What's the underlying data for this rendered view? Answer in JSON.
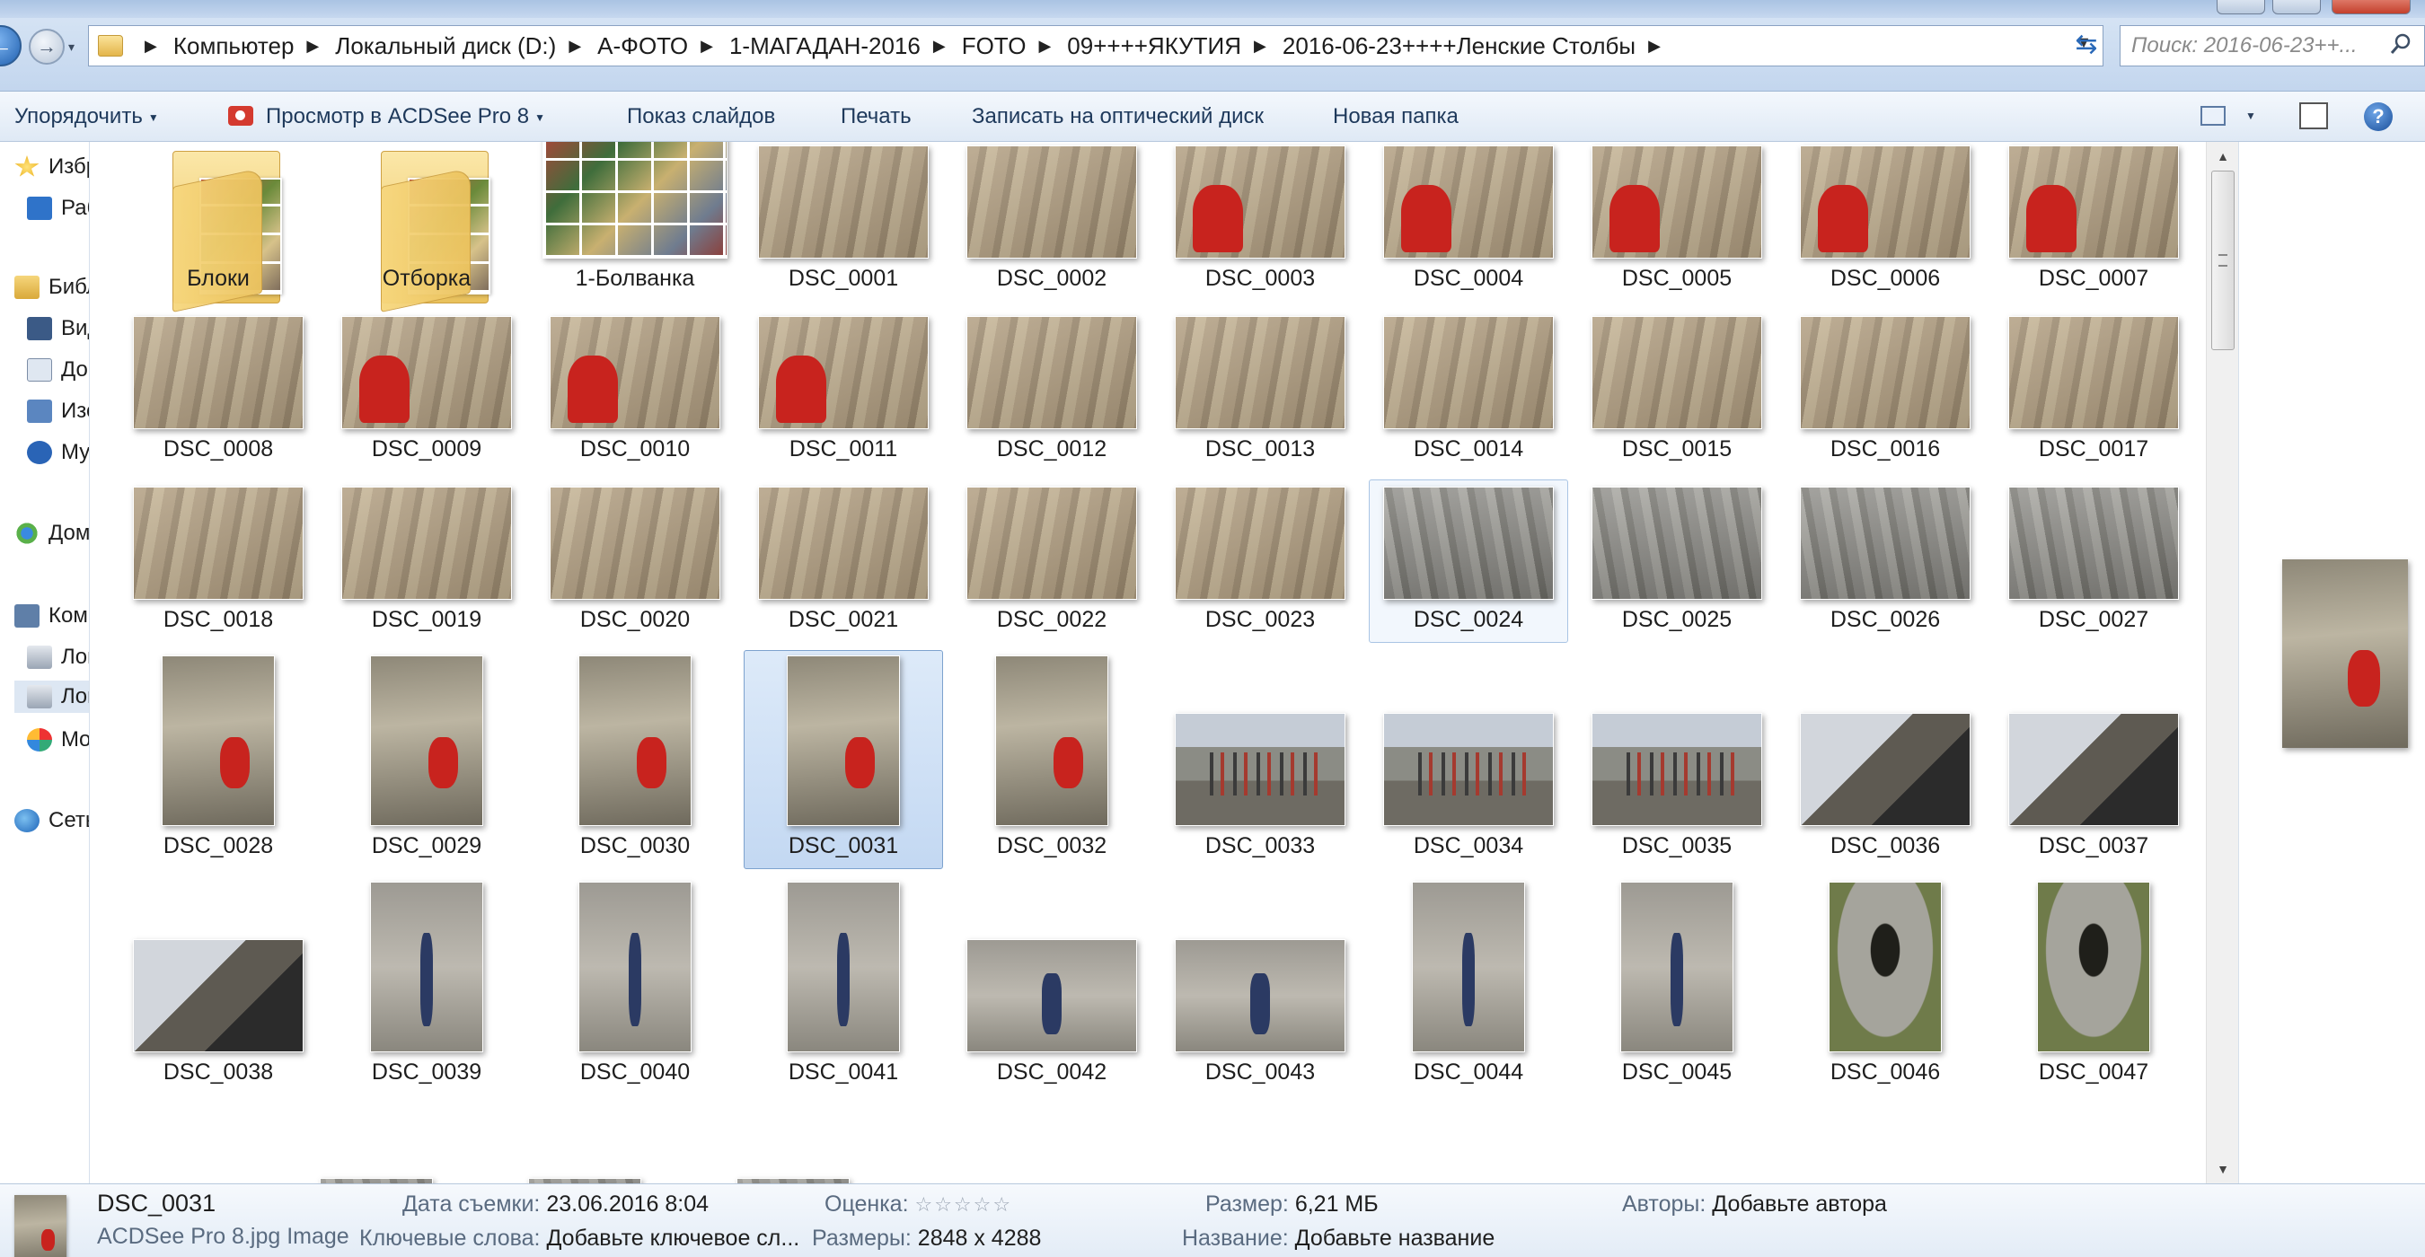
{
  "address": {
    "crumbs": [
      "Компьютер",
      "Локальный диск (D:)",
      "А-ФОТО",
      "1-МАГАДАН-2016",
      "FOTO",
      "09++++ЯКУТИЯ",
      "2016-06-23++++Ленские Столбы"
    ],
    "search_placeholder": "Поиск: 2016-06-23++..."
  },
  "toolbar": {
    "organize": "Упорядочить",
    "acdsee": "Просмотр в ACDSee Pro 8",
    "slideshow": "Показ слайдов",
    "print": "Печать",
    "burn": "Записать на оптический диск",
    "new_folder": "Новая папка"
  },
  "nav": {
    "items": [
      {
        "label": "Избранное",
        "icon": "star-icon"
      },
      {
        "label": "Рабочий стол",
        "icon": "desktop-icon"
      },
      {
        "label": "Библиотеки",
        "icon": "library-icon"
      },
      {
        "label": "Видео",
        "icon": "video-icon"
      },
      {
        "label": "Документы",
        "icon": "documents-icon"
      },
      {
        "label": "Изображения",
        "icon": "pictures-icon"
      },
      {
        "label": "Музыка",
        "icon": "music-icon"
      },
      {
        "label": "Домашняя группа",
        "icon": "homegroup-icon"
      },
      {
        "label": "Компьютер",
        "icon": "computer-icon"
      },
      {
        "label": "Локальный диск (C:)",
        "icon": "drive-icon"
      },
      {
        "label": "Локальный диск (D:)",
        "icon": "drive-icon"
      },
      {
        "label": "Mozilla Firefox",
        "icon": "app-icon"
      },
      {
        "label": "Сеть",
        "icon": "network-icon"
      }
    ]
  },
  "files": [
    {
      "name": "Блоки",
      "kind": "folder"
    },
    {
      "name": "Отборка",
      "kind": "folder"
    },
    {
      "name": "1-Болванка",
      "kind": "collage"
    },
    {
      "name": "DSC_0001",
      "kind": "rock"
    },
    {
      "name": "DSC_0002",
      "kind": "rock"
    },
    {
      "name": "DSC_0003",
      "kind": "rock-red"
    },
    {
      "name": "DSC_0004",
      "kind": "rock-red"
    },
    {
      "name": "DSC_0005",
      "kind": "rock-red"
    },
    {
      "name": "DSC_0006",
      "kind": "rock-red"
    },
    {
      "name": "DSC_0007",
      "kind": "rock-red"
    },
    {
      "name": "DSC_0008",
      "kind": "rock"
    },
    {
      "name": "DSC_0009",
      "kind": "rock-red"
    },
    {
      "name": "DSC_0010",
      "kind": "rock-red"
    },
    {
      "name": "DSC_0011",
      "kind": "rock-red"
    },
    {
      "name": "DSC_0012",
      "kind": "rock"
    },
    {
      "name": "DSC_0013",
      "kind": "rock"
    },
    {
      "name": "DSC_0014",
      "kind": "rock"
    },
    {
      "name": "DSC_0015",
      "kind": "rock"
    },
    {
      "name": "DSC_0016",
      "kind": "rock"
    },
    {
      "name": "DSC_0017",
      "kind": "rock"
    },
    {
      "name": "DSC_0018",
      "kind": "rock"
    },
    {
      "name": "DSC_0019",
      "kind": "rock"
    },
    {
      "name": "DSC_0020",
      "kind": "rock"
    },
    {
      "name": "DSC_0021",
      "kind": "rock"
    },
    {
      "name": "DSC_0022",
      "kind": "rock"
    },
    {
      "name": "DSC_0023",
      "kind": "rock"
    },
    {
      "name": "DSC_0024",
      "kind": "grey",
      "state": "hover"
    },
    {
      "name": "DSC_0025",
      "kind": "grey"
    },
    {
      "name": "DSC_0026",
      "kind": "grey"
    },
    {
      "name": "DSC_0027",
      "kind": "grey"
    },
    {
      "name": "DSC_0028",
      "kind": "portrait"
    },
    {
      "name": "DSC_0029",
      "kind": "portrait"
    },
    {
      "name": "DSC_0030",
      "kind": "portrait"
    },
    {
      "name": "DSC_0031",
      "kind": "portrait",
      "state": "selected"
    },
    {
      "name": "DSC_0032",
      "kind": "portrait"
    },
    {
      "name": "DSC_0033",
      "kind": "group"
    },
    {
      "name": "DSC_0034",
      "kind": "group"
    },
    {
      "name": "DSC_0035",
      "kind": "group"
    },
    {
      "name": "DSC_0036",
      "kind": "dog"
    },
    {
      "name": "DSC_0037",
      "kind": "dog"
    },
    {
      "name": "DSC_0038",
      "kind": "dog"
    },
    {
      "name": "DSC_0039",
      "kind": "climb-portrait"
    },
    {
      "name": "DSC_0040",
      "kind": "climb-portrait"
    },
    {
      "name": "DSC_0041",
      "kind": "climb-portrait"
    },
    {
      "name": "DSC_0042",
      "kind": "climb"
    },
    {
      "name": "DSC_0043",
      "kind": "climb"
    },
    {
      "name": "DSC_0044",
      "kind": "climb-portrait"
    },
    {
      "name": "DSC_0045",
      "kind": "climb-portrait"
    },
    {
      "name": "DSC_0046",
      "kind": "cave"
    },
    {
      "name": "DSC_0047",
      "kind": "cave"
    }
  ],
  "details": {
    "name": "DSC_0031",
    "type": "ACDSee Pro 8.jpg Image",
    "date_key": "Дата съемки:",
    "date_val": "23.06.2016 8:04",
    "keywords_key": "Ключевые слова:",
    "keywords_val": "Добавьте ключевое сл...",
    "rating_key": "Оценка:",
    "rating_val": "☆☆☆☆☆",
    "dims_key": "Размеры:",
    "dims_val": "2848 x 4288",
    "size_key": "Размер:",
    "size_val": "6,21 МБ",
    "title_key": "Название:",
    "title_val": "Добавьте название",
    "authors_key": "Авторы:",
    "authors_val": "Добавьте автора"
  },
  "colors": {
    "accent": "#1e395b",
    "selection": "#cde0f7",
    "window": "#c3d6ee"
  }
}
